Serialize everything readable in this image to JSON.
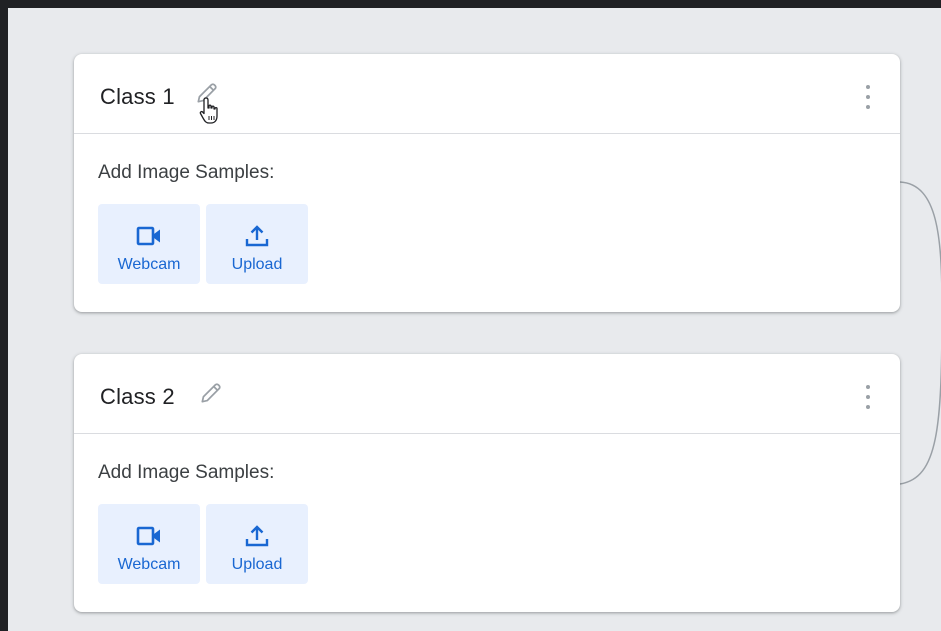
{
  "colors": {
    "accent": "#1967d2",
    "button_bg": "#e8f0fe",
    "card_bg": "#ffffff",
    "canvas_bg": "#e8eaed",
    "outer_bg": "#202124"
  },
  "classes": [
    {
      "name": "Class 1",
      "edit_icon": "pencil-icon",
      "menu_icon": "more-vert-icon",
      "samples_label": "Add Image Samples:",
      "buttons": [
        {
          "label": "Webcam",
          "icon": "videocam-icon"
        },
        {
          "label": "Upload",
          "icon": "upload-icon"
        }
      ]
    },
    {
      "name": "Class 2",
      "edit_icon": "pencil-icon",
      "menu_icon": "more-vert-icon",
      "samples_label": "Add Image Samples:",
      "buttons": [
        {
          "label": "Webcam",
          "icon": "videocam-icon"
        },
        {
          "label": "Upload",
          "icon": "upload-icon"
        }
      ]
    }
  ],
  "cursor": "hand-pointer-icon"
}
